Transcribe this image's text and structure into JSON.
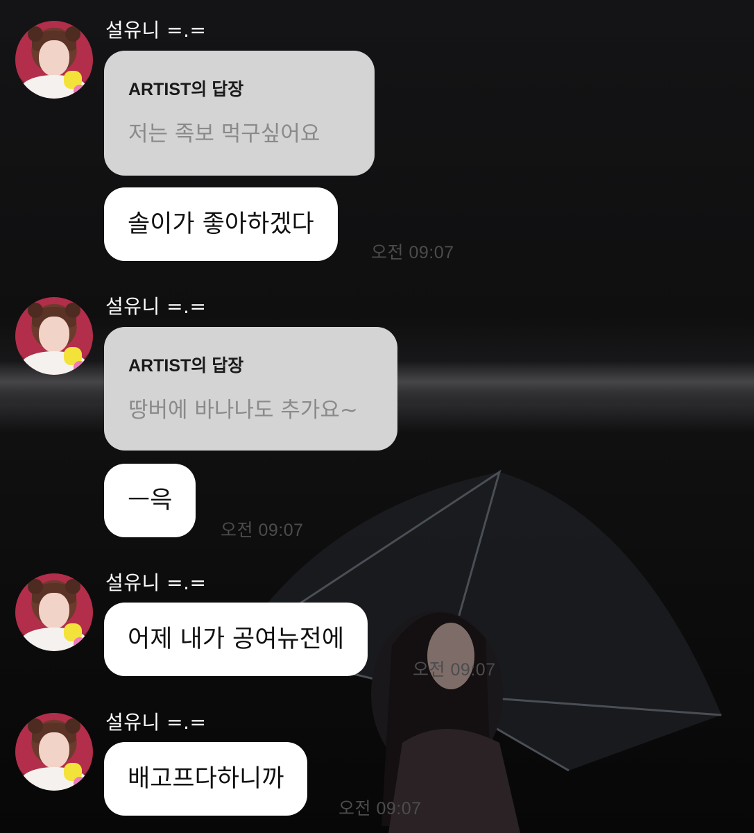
{
  "chat": {
    "messages": [
      {
        "sender": "설유니 =.=",
        "reply_title": "ARTIST의 답장",
        "reply_text": "저는 족보 먹구싶어요",
        "text": "솔이가 좋아하겠다",
        "time": "오전 09:07"
      },
      {
        "sender": "설유니 =.=",
        "reply_title": "ARTIST의 답장",
        "reply_text": "땅버에 바나나도 추가요~",
        "text": "ㅡ윽",
        "time": "오전 09:07"
      },
      {
        "sender": "설유니 =.=",
        "text": "어제 내가 공여뉴전에",
        "time": "오전 09:07"
      },
      {
        "sender": "설유니 =.=",
        "text": "배고프다하니까",
        "time": "오전 09:07"
      }
    ]
  },
  "colors": {
    "bubble": "#ffffff",
    "reply_card": "#d4d4d5",
    "sender_name": "#ffffff",
    "timestamp": "#4c4c4f"
  },
  "icons": {
    "avatar": "profile-photo",
    "background": "umbrella-photo"
  }
}
